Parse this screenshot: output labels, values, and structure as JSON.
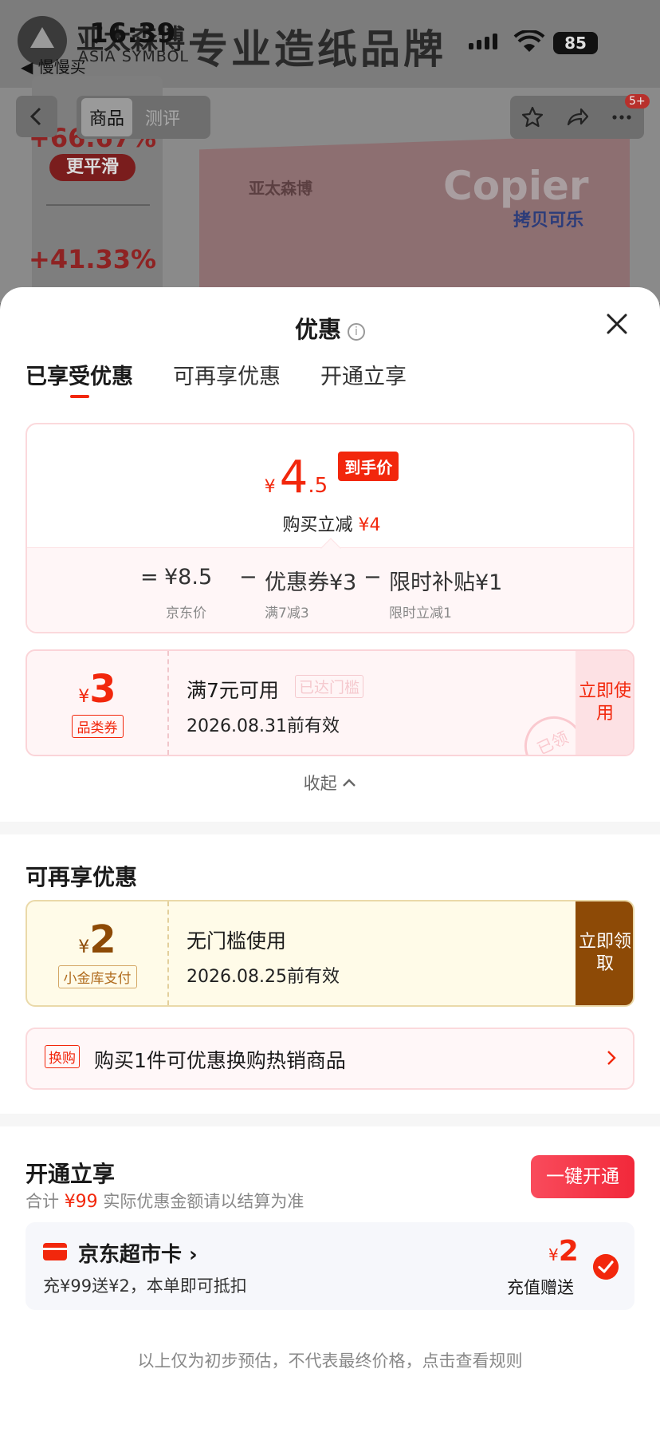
{
  "status_bar": {
    "time": "16:39",
    "back_app": "◀ 慢慢买",
    "battery": "85"
  },
  "background_page": {
    "brand_cn": "亚太森博",
    "brand_en": "ASIA SYMBOL",
    "slogan": "专业造纸品牌",
    "nav_tabs": [
      "商品",
      "测评"
    ],
    "badge": "5+",
    "stat1": "+66.67%",
    "stat1_label": "更平滑",
    "stat2": "+41.33%",
    "paper_brand": "亚太森博",
    "paper_copier": "Copier",
    "paper_kaobei": "拷贝可乐"
  },
  "sheet": {
    "title": "优惠",
    "tabs": [
      "已享受优惠",
      "可再享优惠",
      "开通立享"
    ],
    "price_card": {
      "yen": "¥",
      "price_int": "4",
      "price_dec": ".5",
      "tag": "到手价",
      "buy_reduce": "购买立减",
      "buy_reduce_amount": "¥4",
      "formula": [
        {
          "op": "=",
          "value": "¥8.5",
          "sub": "京东价"
        },
        {
          "op": "−",
          "value": "优惠券¥3",
          "sub": "满7减3"
        },
        {
          "op": "−",
          "value": "限时补贴¥1",
          "sub": "限时立减1"
        }
      ]
    },
    "coupon_red": {
      "yen": "¥",
      "amount": "3",
      "label": "品类券",
      "condition": "满7元可用",
      "overlap_text": "已达门槛",
      "validity": "2026.08.31前有效",
      "button": "立即使用",
      "stamp": "已领"
    },
    "collapse": "收起",
    "more_title": "可再享优惠",
    "coupon_gold": {
      "yen": "¥",
      "amount": "2",
      "label": "小金库支付",
      "condition": "无门槛使用",
      "validity": "2026.08.25前有效",
      "button": "立即领取"
    },
    "exchange": {
      "tag": "换购",
      "text": "购买1件可优惠换购热销商品"
    },
    "open_title": "开通立享",
    "open_button": "一键开通",
    "total_prefix": "合计",
    "total_amount": "¥99",
    "total_note": "实际优惠金额请以结算为准",
    "card": {
      "name": "京东超市卡 ›",
      "desc": "充¥99送¥2，本单即可抵扣",
      "yen": "¥",
      "amount": "2",
      "gift": "充值赠送",
      "selected": true
    },
    "disclaimer": "以上仅为初步预估，不代表最终价格，点击查看规则"
  },
  "colors": {
    "accent": "#f2270c",
    "gold": "#8d4a06"
  }
}
